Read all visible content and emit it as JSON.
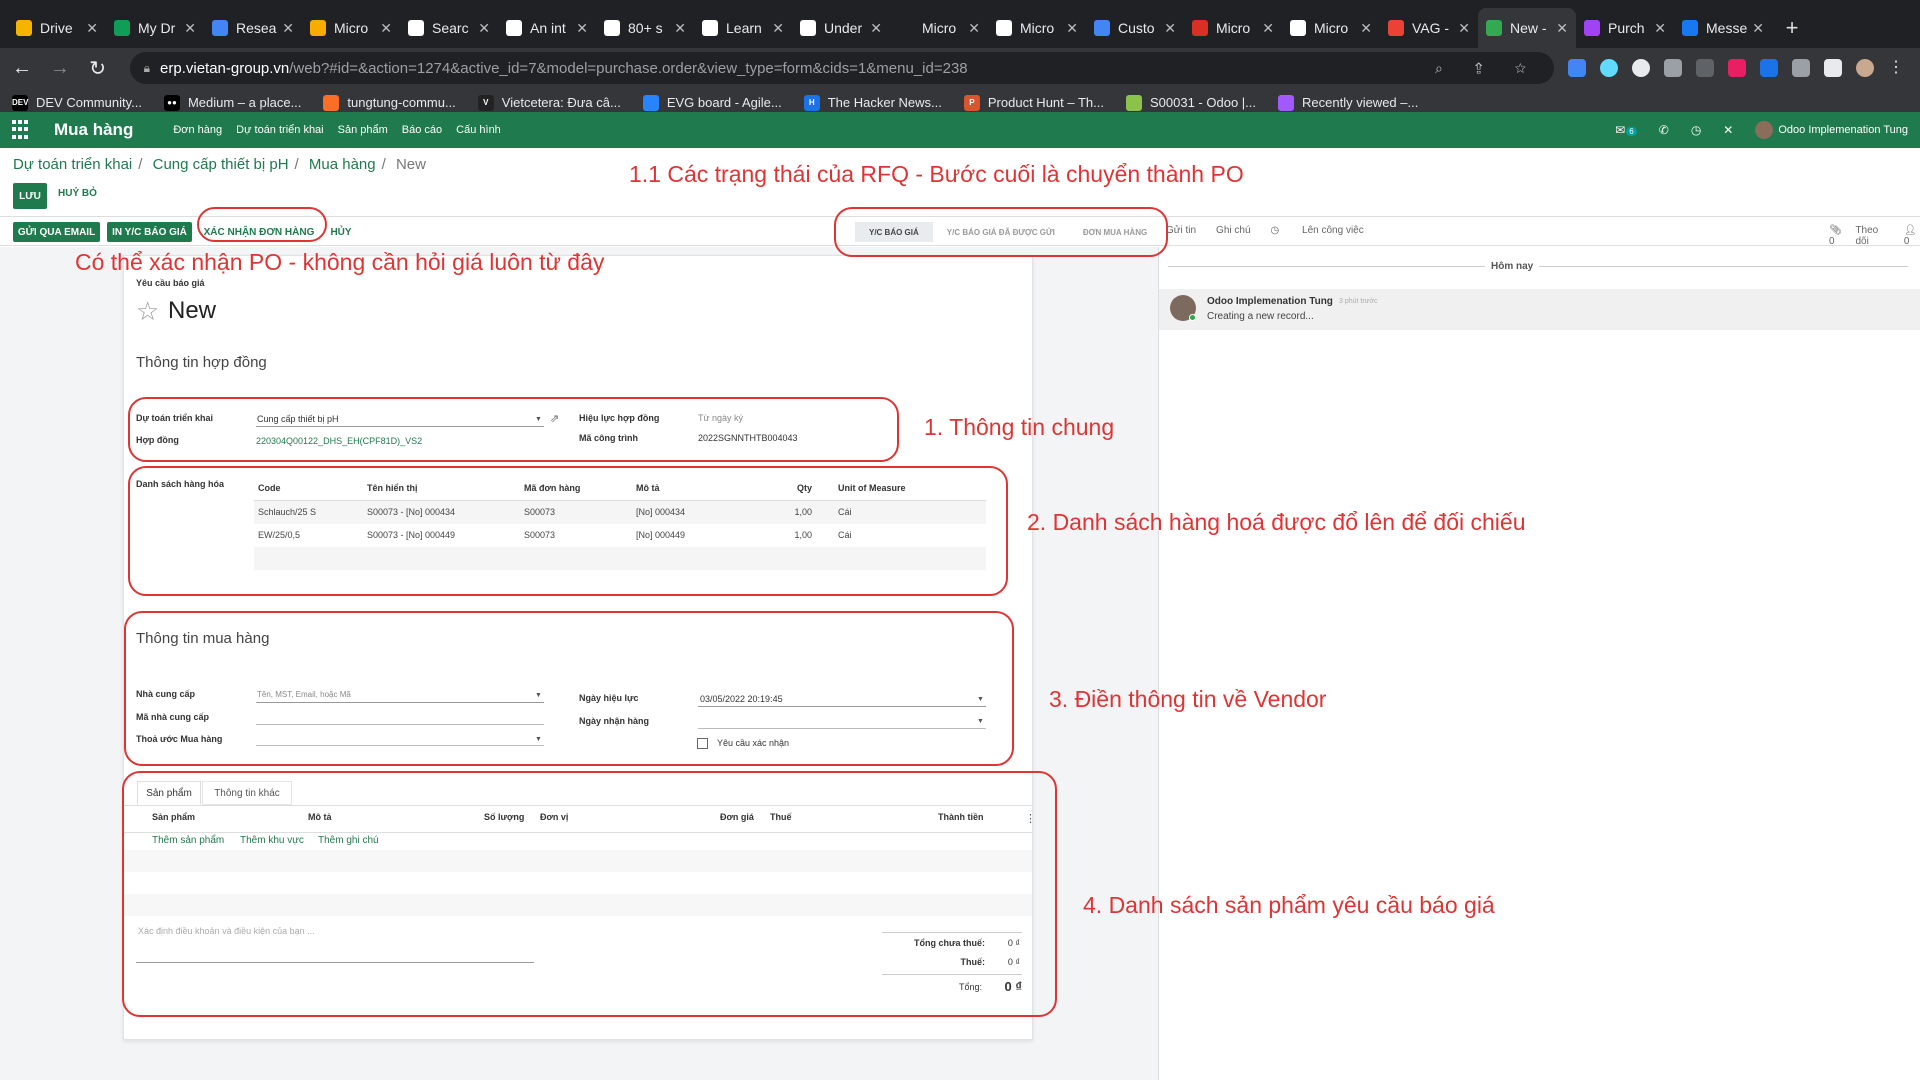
{
  "browser": {
    "tabs": [
      {
        "title": "Drive",
        "color": "#f4b400"
      },
      {
        "title": "My Dr",
        "color": "#0f9d58"
      },
      {
        "title": "Resea",
        "color": "#4285f4"
      },
      {
        "title": "Micro",
        "color": "#f9ab00"
      },
      {
        "title": "Searc",
        "color": "#ffffff"
      },
      {
        "title": "An int",
        "color": "#ffffff"
      },
      {
        "title": "80+ s",
        "color": "#ffffff"
      },
      {
        "title": "Learn",
        "color": "#ffffff"
      },
      {
        "title": "Under",
        "color": "#ffffff"
      },
      {
        "title": "Micro",
        "color": "#202124"
      },
      {
        "title": "Micro",
        "color": "#ffffff"
      },
      {
        "title": "Custo",
        "color": "#4285f4"
      },
      {
        "title": "Micro",
        "color": "#d93025"
      },
      {
        "title": "Micro",
        "color": "#ffffff"
      },
      {
        "title": "VAG -",
        "color": "#ea4335"
      },
      {
        "title": "New -",
        "color": "#34a853"
      },
      {
        "title": "Purch",
        "color": "#a142f4"
      },
      {
        "title": "Messe",
        "color": "#1877f2"
      }
    ],
    "active_tab_index": 15,
    "new_tab_glyph": "+",
    "url_host": "erp.vietan-group.vn",
    "url_path": "/web?#id=&action=1274&active_id=7&model=purchase.order&view_type=form&cids=1&menu_id=238",
    "bookmarks": [
      {
        "label": "DEV Community...",
        "icon": "DEV",
        "color": "#000000"
      },
      {
        "label": "Medium – a place...",
        "icon": "●●",
        "color": "#000000"
      },
      {
        "label": "tungtung-commu...",
        "icon": "",
        "color": "#fc6d26"
      },
      {
        "label": "Vietcetera: Đưa câ...",
        "icon": "V",
        "color": "#222222"
      },
      {
        "label": "EVG board - Agile...",
        "icon": "",
        "color": "#2684ff"
      },
      {
        "label": "The Hacker News...",
        "icon": "H",
        "color": "#1a73e8"
      },
      {
        "label": "Product Hunt – Th...",
        "icon": "P",
        "color": "#da552f"
      },
      {
        "label": "S00031 - Odoo |...",
        "icon": "",
        "color": "#8bc34a"
      },
      {
        "label": "Recently viewed –...",
        "icon": "",
        "color": "#a259ff"
      }
    ]
  },
  "odoo": {
    "app_name": "Mua hàng",
    "menu": [
      "Đơn hàng",
      "Dự toán triển khai",
      "Sản phẩm",
      "Báo cáo",
      "Cấu hình"
    ],
    "message_count": "6",
    "user_name": "Odoo Implemenation Tung"
  },
  "breadcrumb": {
    "items": [
      "Dự toán triển khai",
      "Cung cấp thiết bị pH",
      "Mua hàng"
    ],
    "current": "New"
  },
  "actions": {
    "save": "LƯU",
    "discard": "HUỶ BỎ",
    "send_email": "GỬI QUA EMAIL",
    "print_rfq": "IN Y/C BÁO GIÁ",
    "confirm_order": "XÁC NHẬN ĐƠN HÀNG",
    "cancel": "HỦY"
  },
  "stages": [
    "Y/C BÁO GIÁ",
    "Y/C BÁO GIÁ ĐÃ ĐƯỢC GỬI",
    "ĐƠN MUA HÀNG"
  ],
  "chatter": {
    "send_message": "Gửi tin",
    "log_note": "Ghi chú",
    "schedule_activity": "Lên công việc",
    "attachments": "0",
    "follow": "Theo dõi",
    "followers": "0",
    "day_separator": "Hôm nay",
    "message": {
      "author": "Odoo Implemenation Tung",
      "time": "3 phút trước",
      "body": "Creating a new record..."
    }
  },
  "form": {
    "doc_type": "Yêu cầu báo giá",
    "name": "New",
    "contract_section": "Thông tin hợp đồng",
    "fields": {
      "project_label": "Dự toán triển khai",
      "project_value": "Cung cấp thiết bị pH",
      "contract_label": "Hợp đồng",
      "contract_value": "220304Q00122_DHS_EH(CPF81D)_VS2",
      "validity_label": "Hiệu lực hợp đồng",
      "validity_value": "Từ ngày ký",
      "work_code_label": "Mã công trình",
      "work_code_value": "2022SGNNTHTB004043"
    },
    "goods": {
      "label": "Danh sách hàng hóa",
      "headers": [
        "Code",
        "Tên hiển thị",
        "Mã đơn hàng",
        "Mô tả",
        "Qty",
        "Unit of Measure"
      ],
      "rows": [
        [
          "Schlauch/25 S",
          "S00073 - [No] 000434",
          "S00073",
          "[No] 000434",
          "1,00",
          "Cái"
        ],
        [
          "EW/25/0,5",
          "S00073 - [No] 000449",
          "S00073",
          "[No] 000449",
          "1,00",
          "Cái"
        ]
      ]
    },
    "purchase_section": "Thông tin mua hàng",
    "vendor": {
      "vendor_label": "Nhà cung cấp",
      "vendor_placeholder": "Tên, MST, Email, hoặc Mã",
      "vendor_ref_label": "Mã nhà cung cấp",
      "agreement_label": "Thoả ước Mua hàng",
      "date_label": "Ngày hiệu lực",
      "date_value": "03/05/2022 20:19:45",
      "receipt_label": "Ngày nhận hàng",
      "ack_label": "Yêu cầu xác nhận"
    },
    "tabs": [
      "Sản phẩm",
      "Thông tin khác"
    ],
    "product_headers": [
      "Sản phẩm",
      "Mô tả",
      "Số lượng",
      "Đơn vị",
      "Đơn giá",
      "Thuế",
      "Thành tiền"
    ],
    "product_links": [
      "Thêm sản phẩm",
      "Thêm khu vực",
      "Thêm ghi chú"
    ],
    "terms_placeholder": "Xác định điều khoản và điều kiện của bạn ...",
    "totals": {
      "untaxed_label": "Tổng chưa thuế:",
      "untaxed_value": "0 ₫",
      "tax_label": "Thuế:",
      "tax_value": "0 ₫",
      "total_label": "Tổng:",
      "total_value": "0 ₫"
    }
  },
  "annotations": {
    "a_status": "1.1 Các trạng thái của RFQ - Bước cuối là chuyển thành PO",
    "a_confirm": "Có thể xác nhận PO - không cần hỏi giá luôn từ đây",
    "a1": "1. Thông tin chung",
    "a2": "2. Danh sách hàng hoá được đổ lên để đối chiếu",
    "a3": "3. Điền thông tin về Vendor",
    "a4": "4. Danh sách sản phẩm yêu cầu báo giá",
    "color": "#e03434"
  }
}
